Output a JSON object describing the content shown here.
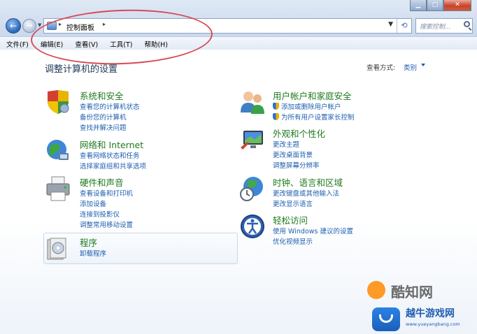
{
  "window": {
    "caption": {
      "minimize": "▁",
      "maximize": "□",
      "close": "✕"
    }
  },
  "navigation": {
    "back_glyph": "←",
    "forward_glyph": "→",
    "history_glyph": "▼"
  },
  "address_bar": {
    "breadcrumb": "控制面板",
    "separator": "▸",
    "dropdown_glyph": "▼",
    "refresh_glyph": "⟲"
  },
  "search": {
    "placeholder": "搜索控制..."
  },
  "menubar": {
    "items": [
      "文件(F)",
      "编辑(E)",
      "查看(V)",
      "工具(T)",
      "帮助(H)"
    ]
  },
  "main": {
    "title": "调整计算机的设置",
    "view_by_label": "查看方式:",
    "view_by_value": "类别"
  },
  "categories": [
    {
      "title": "系统和安全",
      "icon": "shield-icon",
      "links": [
        "查看您的计算机状态",
        "备份您的计算机",
        "查找并解决问题"
      ]
    },
    {
      "title": "网络和 Internet",
      "icon": "network-globe-icon",
      "links": [
        "查看网络状态和任务",
        "选择家庭组和共享选项"
      ]
    },
    {
      "title": "硬件和声音",
      "icon": "printer-icon",
      "links": [
        "查看设备和打印机",
        "添加设备",
        "连接到投影仪",
        "调整常用移动设置"
      ]
    },
    {
      "title": "程序",
      "icon": "programs-icon",
      "links": [
        "卸载程序"
      ]
    },
    {
      "title": "用户帐户和家庭安全",
      "icon": "users-icon",
      "links": [
        "添加或删除用户帐户",
        "为所有用户设置家长控制"
      ]
    },
    {
      "title": "外观和个性化",
      "icon": "display-icon",
      "links": [
        "更改主题",
        "更改桌面背景",
        "调整屏幕分辨率"
      ]
    },
    {
      "title": "时钟、语言和区域",
      "icon": "clock-globe-icon",
      "links": [
        "更改键盘或其他输入法",
        "更改显示语言"
      ]
    },
    {
      "title": "轻松访问",
      "icon": "accessibility-icon",
      "links": [
        "使用 Windows 建议的设置",
        "优化视频显示"
      ]
    }
  ],
  "watermarks": {
    "brand1": "酷知网",
    "brand2": "越牛游戏网",
    "brand2_url": "www.yueyangbang.com"
  },
  "colors": {
    "category_title": "#1f7a1f",
    "link": "#1e5eb0",
    "annotation": "#d84a55"
  }
}
